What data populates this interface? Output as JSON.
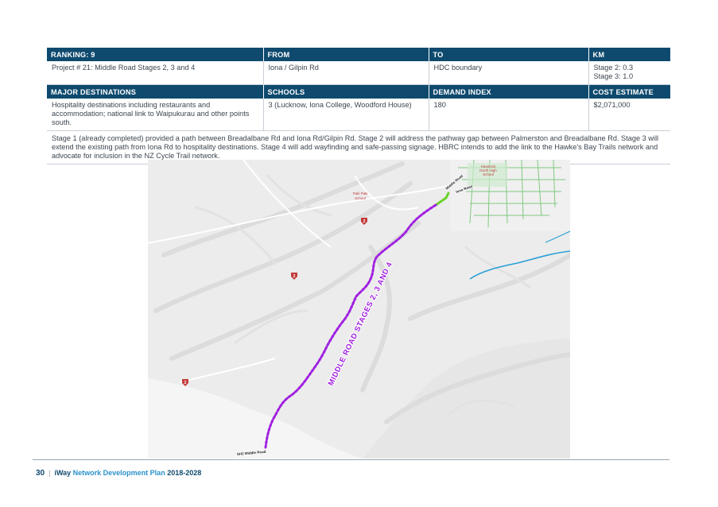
{
  "table": {
    "header1": {
      "ranking": "RANKING: 9",
      "from": "FROM",
      "to": "TO",
      "km": "KM"
    },
    "row1": {
      "project": "Project # 21: Middle Road Stages 2, 3 and 4",
      "from": "Iona / Gilpin Rd",
      "to": "HDC boundary",
      "km_line1": "Stage 2: 0.3",
      "km_line2": "Stage 3: 1.0"
    },
    "header2": {
      "destinations": "MAJOR DESTINATIONS",
      "schools": "SCHOOLS",
      "demand": "DEMAND INDEX",
      "cost": "COST ESTIMATE"
    },
    "row2": {
      "destinations": "Hospitality destinations including restaurants and accommodation; national link to Waipukurau and other points south.",
      "schools": "3 (Lucknow, Iona College, Woodford House)",
      "demand": "180",
      "cost": "$2,071,000"
    },
    "description": "Stage 1 (already completed) provided a path between Breadalbane Rd and Iona Rd/Gilpin Rd. Stage 2 will address the pathway gap between Palmerston and Breadalbane Rd. Stage 3 will extend the existing path from Iona Rd to hospitality destinations. Stage 4 will add wayfinding and safe-passing signage. HBRC intends to add the link to the Hawke's Bay Trails network and advocate for inclusion in the NZ Cycle Trail network."
  },
  "map": {
    "route_label": "MIDDLE ROAD STAGES 2, 3 AND 4",
    "school_label_line1": "Havelock",
    "school_label_line2": "North High",
    "school_label_line3": "School",
    "paki_label_line1": "Paki Paki",
    "paki_label_line2": "School",
    "road_label_top": "Middle Road",
    "road_label_mid": "Iona Road",
    "road_label_bottom": "SH2 Middle Road",
    "highway_marker": "2",
    "route_color": "#a020e0",
    "stage1_color": "#6ad22a",
    "river_color": "#2a9fd6"
  },
  "footer": {
    "page": "30",
    "brand": "iWay",
    "title": "Network Development Plan",
    "years": "2018-2028"
  }
}
